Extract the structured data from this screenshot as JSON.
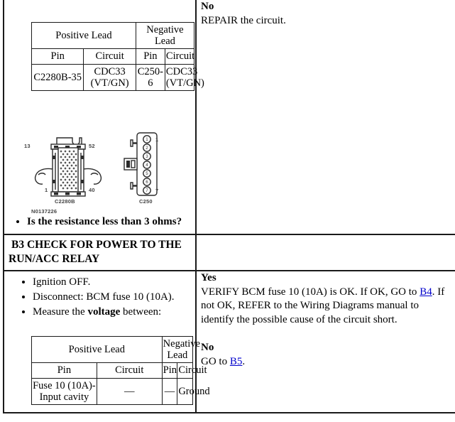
{
  "document": {
    "type": "automotive-diagnostic-pinpoint-test"
  },
  "rows": [
    {
      "id": "b2-continuation",
      "left": {
        "lead_table": {
          "group_headers": [
            "Positive Lead",
            "Negative Lead"
          ],
          "column_headers": [
            "Pin",
            "Circuit",
            "Pin",
            "Circuit"
          ],
          "values": [
            "C2280B-35",
            "CDC33 (VT/GN)",
            "C250-6",
            "CDC33 (VT/GN)"
          ]
        },
        "figure": {
          "connector_left_label": "C2280B",
          "connector_left_pins": [
            "13",
            "52",
            "1",
            "40"
          ],
          "connector_right_label": "C250",
          "connector_right_pins": [
            "1",
            "2",
            "3",
            "4",
            "5",
            "6",
            "7"
          ],
          "connector_right_end_labels": [
            "1",
            "7"
          ],
          "figure_id": "N0137226"
        },
        "question": "Is the resistance less than 3 ohms?"
      },
      "right": {
        "blocks": [
          {
            "label": "No",
            "text": "REPAIR the circuit."
          }
        ]
      }
    },
    {
      "id": "b3",
      "left": {
        "heading_index": "B3",
        "heading_text": "CHECK FOR POWER TO THE RUN/ACC RELAY",
        "steps": [
          "Ignition OFF.",
          "Disconnect: BCM fuse 10 (10A).",
          "Measure the voltage between:"
        ],
        "step_emphasis": "voltage",
        "lead_table": {
          "group_headers": [
            "Positive Lead",
            "Negative Lead"
          ],
          "column_headers": [
            "Pin",
            "Circuit",
            "Pin",
            "Circuit"
          ],
          "values": [
            "Fuse 10 (10A)-Input cavity",
            "—",
            "—",
            "Ground"
          ]
        }
      },
      "right": {
        "blocks": [
          {
            "label": "Yes",
            "text_before_link": "VERIFY BCM fuse 10 (10A) is OK. If OK, GO to ",
            "link": "B4",
            "text_after_link": ". If not OK, REFER to the Wiring Diagrams manual to identify the possible cause of the circuit short."
          },
          {
            "label": "No",
            "text_before_link": "GO to ",
            "link": "B5",
            "text_after_link": "."
          }
        ]
      }
    }
  ],
  "colors": {
    "border": "#1a1a1a",
    "link": "#0000cc",
    "text": "#000000",
    "caption": "#444444"
  }
}
